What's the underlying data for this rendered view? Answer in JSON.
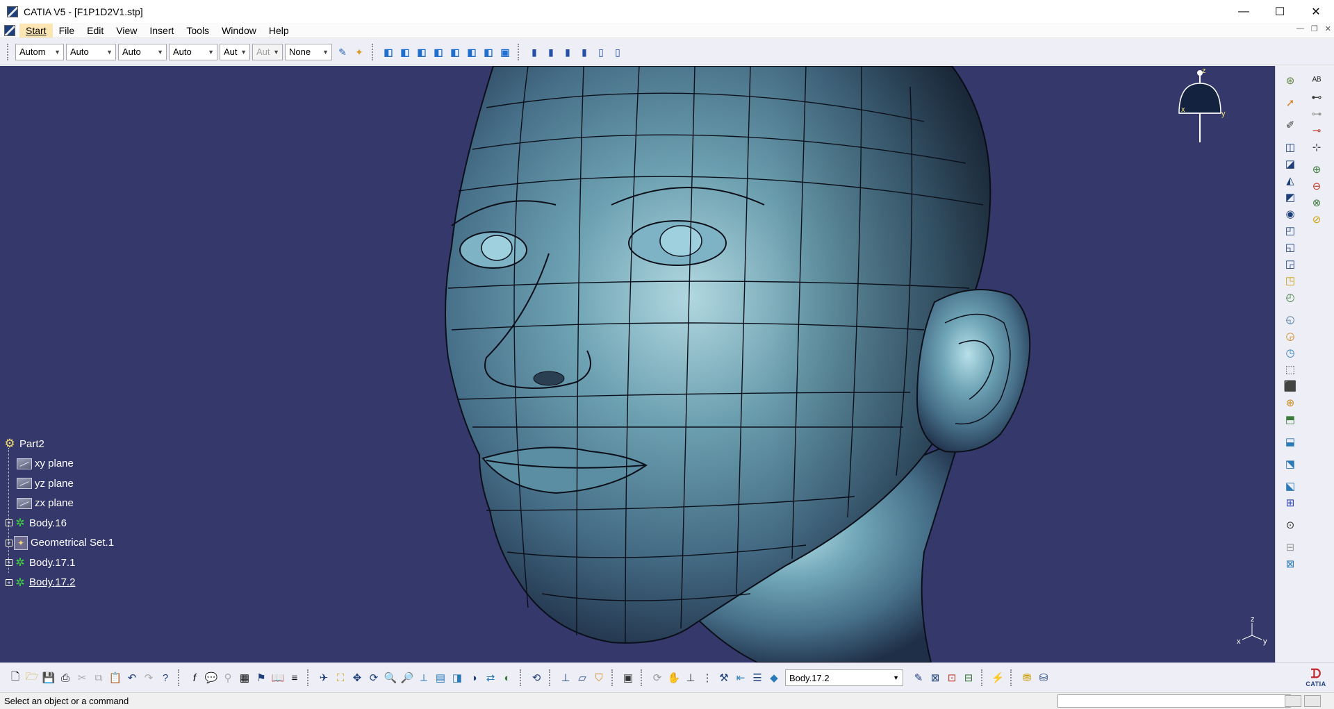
{
  "window": {
    "title": "CATIA V5 - [F1P1D2V1.stp]",
    "controls": {
      "minimize": "—",
      "maximize": "☐",
      "close": "✕"
    }
  },
  "menubar": {
    "items": [
      {
        "label": "Start",
        "underline": "S"
      },
      {
        "label": "File",
        "underline": "F"
      },
      {
        "label": "Edit",
        "underline": "E"
      },
      {
        "label": "View",
        "underline": "V"
      },
      {
        "label": "Insert",
        "underline": "I"
      },
      {
        "label": "Tools",
        "underline": "T"
      },
      {
        "label": "Window",
        "underline": "W"
      },
      {
        "label": "Help",
        "underline": "H"
      }
    ],
    "active_item": "Start"
  },
  "graphic_properties_toolbar": {
    "combos": [
      {
        "value": "Autom",
        "state": "enabled"
      },
      {
        "value": "Auto",
        "state": "enabled"
      },
      {
        "value": "Auto",
        "state": "enabled"
      },
      {
        "value": "Auto",
        "state": "enabled"
      },
      {
        "value": "Aut",
        "state": "enabled"
      },
      {
        "value": "Aut",
        "state": "disabled"
      },
      {
        "value": "None",
        "state": "enabled"
      }
    ]
  },
  "spec_tree": {
    "root": "Part2",
    "items": [
      {
        "label": "xy plane",
        "type": "plane"
      },
      {
        "label": "yz plane",
        "type": "plane"
      },
      {
        "label": "zx plane",
        "type": "plane"
      },
      {
        "label": "Body.16",
        "type": "body"
      },
      {
        "label": "Geometrical Set.1",
        "type": "geometrical-set"
      },
      {
        "label": "Body.17.1",
        "type": "body"
      },
      {
        "label": "Body.17.2",
        "type": "body",
        "underlined": true
      }
    ]
  },
  "compass": {
    "x_label": "x",
    "y_label": "y",
    "z_label": "z"
  },
  "axis_triad": {
    "x_label": "x",
    "y_label": "y",
    "z_label": "z"
  },
  "bottom_toolbar": {
    "current_body": "Body.17.2"
  },
  "status_bar": {
    "message": "Select an object or a command",
    "command_input": ""
  },
  "branding": {
    "logo_text": "CATIA"
  },
  "colors": {
    "viewport_background": "#35386a",
    "toolbar_background": "#eeeef6",
    "tree_text": "#ffffff",
    "active_menu": "#fce6b4",
    "model_surface": "#5f8fa3"
  }
}
